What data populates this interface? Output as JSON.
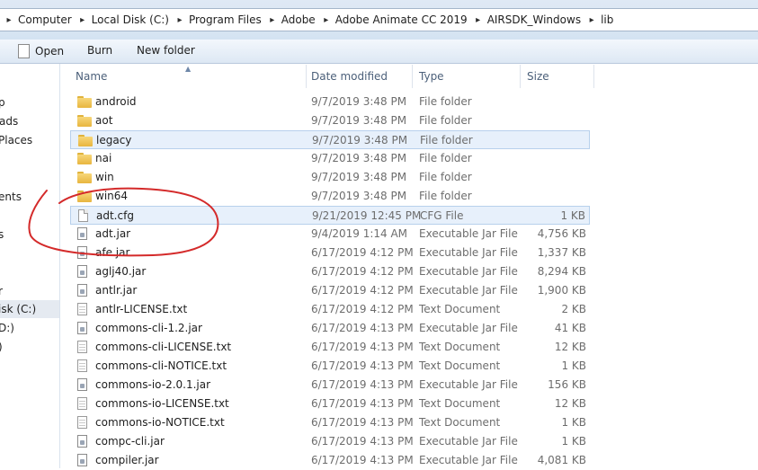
{
  "breadcrumb": [
    "Computer",
    "Local Disk (C:)",
    "Program Files",
    "Adobe",
    "Adobe Animate CC 2019",
    "AIRSDK_Windows",
    "lib"
  ],
  "toolbar": {
    "open_label": "Open",
    "burn_label": "Burn",
    "new_folder_label": "New folder"
  },
  "navpane": {
    "items": [
      "p",
      "ads",
      "Places",
      "ents",
      "s",
      "r",
      "isk (C:)",
      "D:)",
      ")"
    ]
  },
  "columns": {
    "name": "Name",
    "date": "Date modified",
    "type": "Type",
    "size": "Size"
  },
  "files": [
    {
      "name": "android",
      "date": "9/7/2019 3:48 PM",
      "type": "File folder",
      "size": "",
      "icon": "folder"
    },
    {
      "name": "aot",
      "date": "9/7/2019 3:48 PM",
      "type": "File folder",
      "size": "",
      "icon": "folder"
    },
    {
      "name": "legacy",
      "date": "9/7/2019 3:48 PM",
      "type": "File folder",
      "size": "",
      "icon": "folder"
    },
    {
      "name": "nai",
      "date": "9/7/2019 3:48 PM",
      "type": "File folder",
      "size": "",
      "icon": "folder"
    },
    {
      "name": "win",
      "date": "9/7/2019 3:48 PM",
      "type": "File folder",
      "size": "",
      "icon": "folder"
    },
    {
      "name": "win64",
      "date": "9/7/2019 3:48 PM",
      "type": "File folder",
      "size": "",
      "icon": "folder"
    },
    {
      "name": "adt.cfg",
      "date": "9/21/2019 12:45 PM",
      "type": "CFG File",
      "size": "1 KB",
      "icon": "doc"
    },
    {
      "name": "adt.jar",
      "date": "9/4/2019 1:14 AM",
      "type": "Executable Jar File",
      "size": "4,756 KB",
      "icon": "jar"
    },
    {
      "name": "afe.jar",
      "date": "6/17/2019 4:12 PM",
      "type": "Executable Jar File",
      "size": "1,337 KB",
      "icon": "jar"
    },
    {
      "name": "aglj40.jar",
      "date": "6/17/2019 4:12 PM",
      "type": "Executable Jar File",
      "size": "8,294 KB",
      "icon": "jar"
    },
    {
      "name": "antlr.jar",
      "date": "6/17/2019 4:12 PM",
      "type": "Executable Jar File",
      "size": "1,900 KB",
      "icon": "jar"
    },
    {
      "name": "antlr-LICENSE.txt",
      "date": "6/17/2019 4:12 PM",
      "type": "Text Document",
      "size": "2 KB",
      "icon": "text"
    },
    {
      "name": "commons-cli-1.2.jar",
      "date": "6/17/2019 4:13 PM",
      "type": "Executable Jar File",
      "size": "41 KB",
      "icon": "jar"
    },
    {
      "name": "commons-cli-LICENSE.txt",
      "date": "6/17/2019 4:13 PM",
      "type": "Text Document",
      "size": "12 KB",
      "icon": "text"
    },
    {
      "name": "commons-cli-NOTICE.txt",
      "date": "6/17/2019 4:13 PM",
      "type": "Text Document",
      "size": "1 KB",
      "icon": "text"
    },
    {
      "name": "commons-io-2.0.1.jar",
      "date": "6/17/2019 4:13 PM",
      "type": "Executable Jar File",
      "size": "156 KB",
      "icon": "jar"
    },
    {
      "name": "commons-io-LICENSE.txt",
      "date": "6/17/2019 4:13 PM",
      "type": "Text Document",
      "size": "12 KB",
      "icon": "text"
    },
    {
      "name": "commons-io-NOTICE.txt",
      "date": "6/17/2019 4:13 PM",
      "type": "Text Document",
      "size": "1 KB",
      "icon": "text"
    },
    {
      "name": "compc-cli.jar",
      "date": "6/17/2019 4:13 PM",
      "type": "Executable Jar File",
      "size": "1 KB",
      "icon": "jar"
    },
    {
      "name": "compiler.jar",
      "date": "6/17/2019 4:13 PM",
      "type": "Executable Jar File",
      "size": "4,081 KB",
      "icon": "jar"
    }
  ],
  "selected_rows": [
    "legacy",
    "adt.cfg"
  ],
  "colors": {
    "annotation": "#d42a2a",
    "selection_bg": "#e7f0fb",
    "selection_border": "#b7d0ec"
  }
}
